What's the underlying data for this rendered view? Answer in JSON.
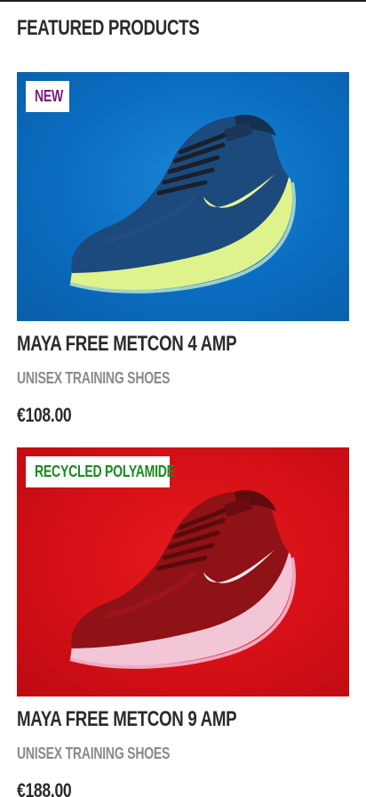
{
  "section": {
    "title": "FEATURED PRODUCTS"
  },
  "products": [
    {
      "badge": "NEW",
      "badge_color": "#7a1a7e",
      "name": "MAYA FREE METCON 4 AMP",
      "category": "UNISEX TRAINING SHOES",
      "price": "€108.00",
      "image_theme": "blue",
      "background_color": "#0a6cc0",
      "shoe_color": "#1b3d6e",
      "accent_color": "#d6f36a",
      "brand_logo_text": "NIKE"
    },
    {
      "badge": "RECYCLED POLYAMIDE",
      "badge_color": "#1c8a1e",
      "name": "MAYA FREE METCON 9 AMP",
      "category": "UNISEX TRAINING SHOES",
      "price": "€188.00",
      "image_theme": "red",
      "background_color": "#d40f16",
      "shoe_color": "#8e1114",
      "accent_color": "#f7dbe6",
      "brand_logo_text": "NIKE"
    }
  ]
}
